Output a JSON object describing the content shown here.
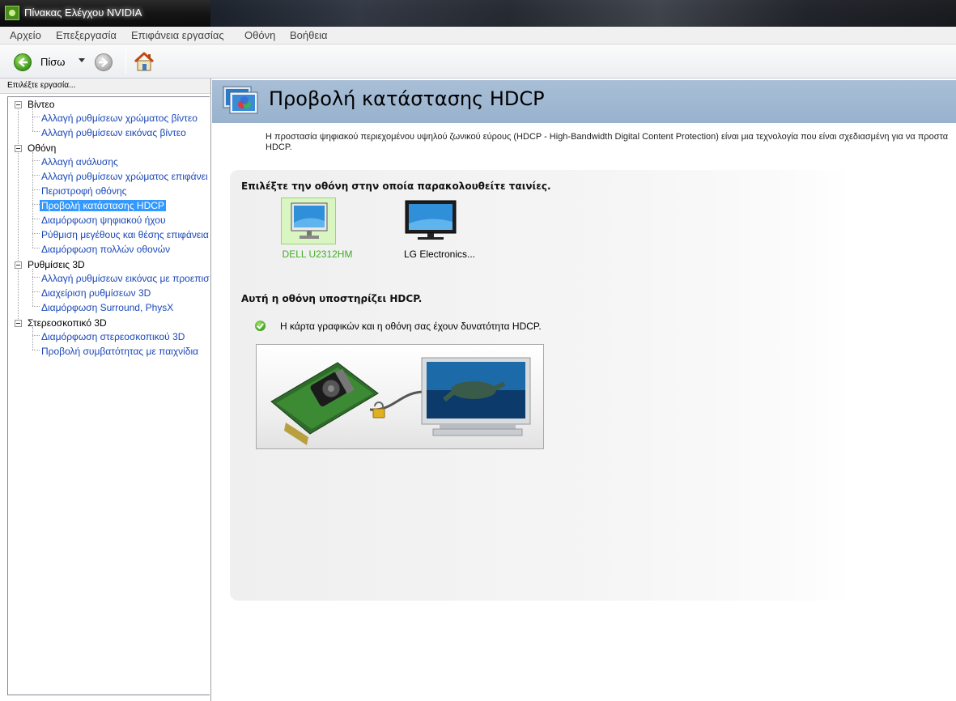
{
  "window": {
    "title": "Πίνακας Ελέγχου NVIDIA"
  },
  "menu": [
    "Αρχείο",
    "Επεξεργασία",
    "Επιφάνεια εργασίας",
    "Οθόνη",
    "Βοήθεια"
  ],
  "toolbar": {
    "back_label": "Πίσω"
  },
  "sidebar": {
    "header": "Επιλέξτε εργασία...",
    "categories": [
      {
        "label": "Βίντεο",
        "items": [
          "Αλλαγή ρυθμίσεων χρώματος βίντεο",
          "Αλλαγή ρυθμίσεων εικόνας βίντεο"
        ]
      },
      {
        "label": "Οθόνη",
        "items": [
          "Αλλαγή ανάλυσης",
          "Αλλαγή ρυθμίσεων χρώματος επιφάνει",
          "Περιστροφή οθόνης",
          "Προβολή κατάστασης HDCP",
          "Διαμόρφωση ψηφιακού ήχου",
          "Ρύθμιση μεγέθους και θέσης επιφάνεια",
          "Διαμόρφωση πολλών οθονών"
        ]
      },
      {
        "label": "Ρυθμίσεις 3D",
        "items": [
          "Αλλαγή ρυθμίσεων εικόνας με προεπισ",
          "Διαχείριση ρυθμίσεων 3D",
          "Διαμόρφωση Surround, PhysX"
        ]
      },
      {
        "label": "Στερεοσκοπικό 3D",
        "items": [
          "Διαμόρφωση στερεοσκοπικού 3D",
          "Προβολή συμβατότητας με παιχνίδια"
        ]
      }
    ],
    "selected": "Προβολή κατάστασης HDCP"
  },
  "main": {
    "title": "Προβολή κατάστασης HDCP",
    "description_line1": "Η προστασία ψηφιακού περιεχομένου υψηλού ζωνικού εύρους (HDCP - High-Bandwidth Digital Content Protection) είναι μια τεχνολογία που είναι σχεδιασμένη για να προστα",
    "description_line2": "HDCP.",
    "select_heading": "Επιλέξτε την οθόνη στην οποία παρακολουθείτε ταινίες.",
    "monitors": [
      {
        "name": "DELL U2312HM",
        "selected": true
      },
      {
        "name": "LG Electronics...",
        "selected": false
      }
    ],
    "support_heading": "Αυτή η οθόνη υποστηρίζει HDCP.",
    "status_text": "Η κάρτα γραφικών και η οθόνη σας έχουν δυνατότητα HDCP."
  },
  "colors": {
    "selected_bg": "#3399ff",
    "link": "#1a47b8",
    "selected_monitor_label": "#3fae23",
    "banner": "#a9bfd7"
  },
  "icons": [
    "nvidia-app-icon",
    "back-arrow-icon",
    "forward-arrow-icon",
    "home-icon",
    "display-settings-icon",
    "monitor-icon",
    "check-icon",
    "graphics-card-illustration",
    "lock-icon"
  ]
}
